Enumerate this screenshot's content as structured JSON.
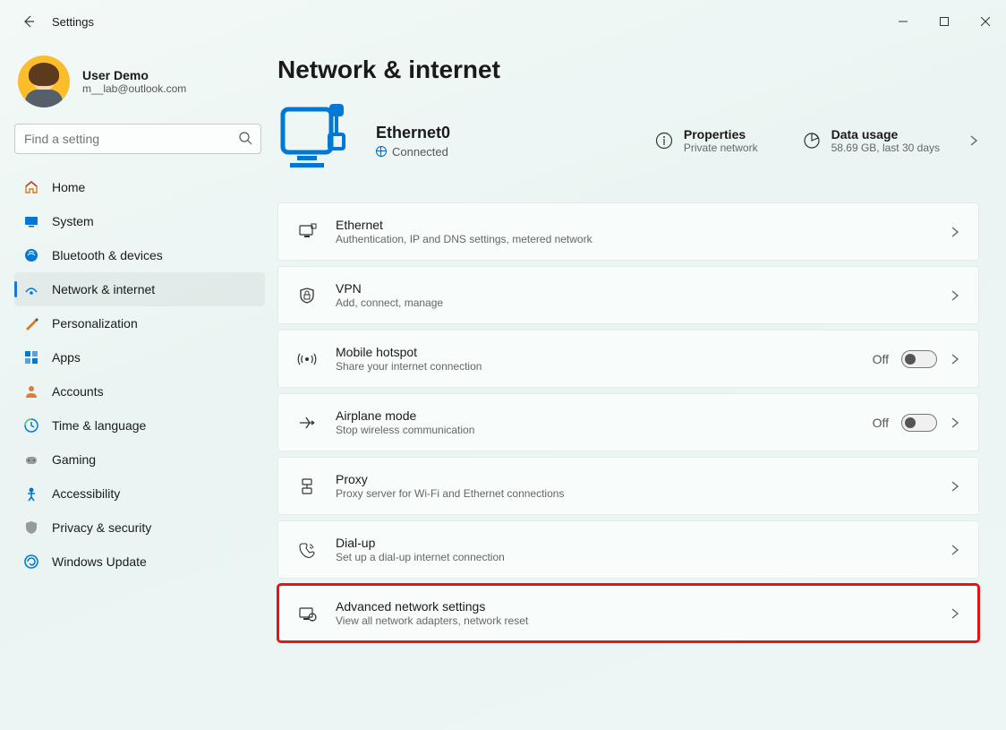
{
  "window": {
    "title": "Settings"
  },
  "user": {
    "name": "User Demo",
    "email": "m__lab@outlook.com"
  },
  "search": {
    "placeholder": "Find a setting"
  },
  "nav": {
    "items": [
      {
        "label": "Home"
      },
      {
        "label": "System"
      },
      {
        "label": "Bluetooth & devices"
      },
      {
        "label": "Network & internet"
      },
      {
        "label": "Personalization"
      },
      {
        "label": "Apps"
      },
      {
        "label": "Accounts"
      },
      {
        "label": "Time & language"
      },
      {
        "label": "Gaming"
      },
      {
        "label": "Accessibility"
      },
      {
        "label": "Privacy & security"
      },
      {
        "label": "Windows Update"
      }
    ],
    "selected_index": 3
  },
  "page": {
    "title": "Network & internet",
    "connection": {
      "name": "Ethernet0",
      "status": "Connected"
    },
    "properties": {
      "title": "Properties",
      "sub": "Private network"
    },
    "data_usage": {
      "title": "Data usage",
      "sub": "58.69 GB, last 30 days"
    },
    "items": [
      {
        "title": "Ethernet",
        "sub": "Authentication, IP and DNS settings, metered network",
        "icon": "ethernet",
        "toggle": null
      },
      {
        "title": "VPN",
        "sub": "Add, connect, manage",
        "icon": "vpn",
        "toggle": null
      },
      {
        "title": "Mobile hotspot",
        "sub": "Share your internet connection",
        "icon": "hotspot",
        "toggle": "Off"
      },
      {
        "title": "Airplane mode",
        "sub": "Stop wireless communication",
        "icon": "airplane",
        "toggle": "Off"
      },
      {
        "title": "Proxy",
        "sub": "Proxy server for Wi-Fi and Ethernet connections",
        "icon": "proxy",
        "toggle": null
      },
      {
        "title": "Dial-up",
        "sub": "Set up a dial-up internet connection",
        "icon": "dialup",
        "toggle": null
      },
      {
        "title": "Advanced network settings",
        "sub": "View all network adapters, network reset",
        "icon": "advanced",
        "toggle": null,
        "highlight": true
      }
    ]
  }
}
